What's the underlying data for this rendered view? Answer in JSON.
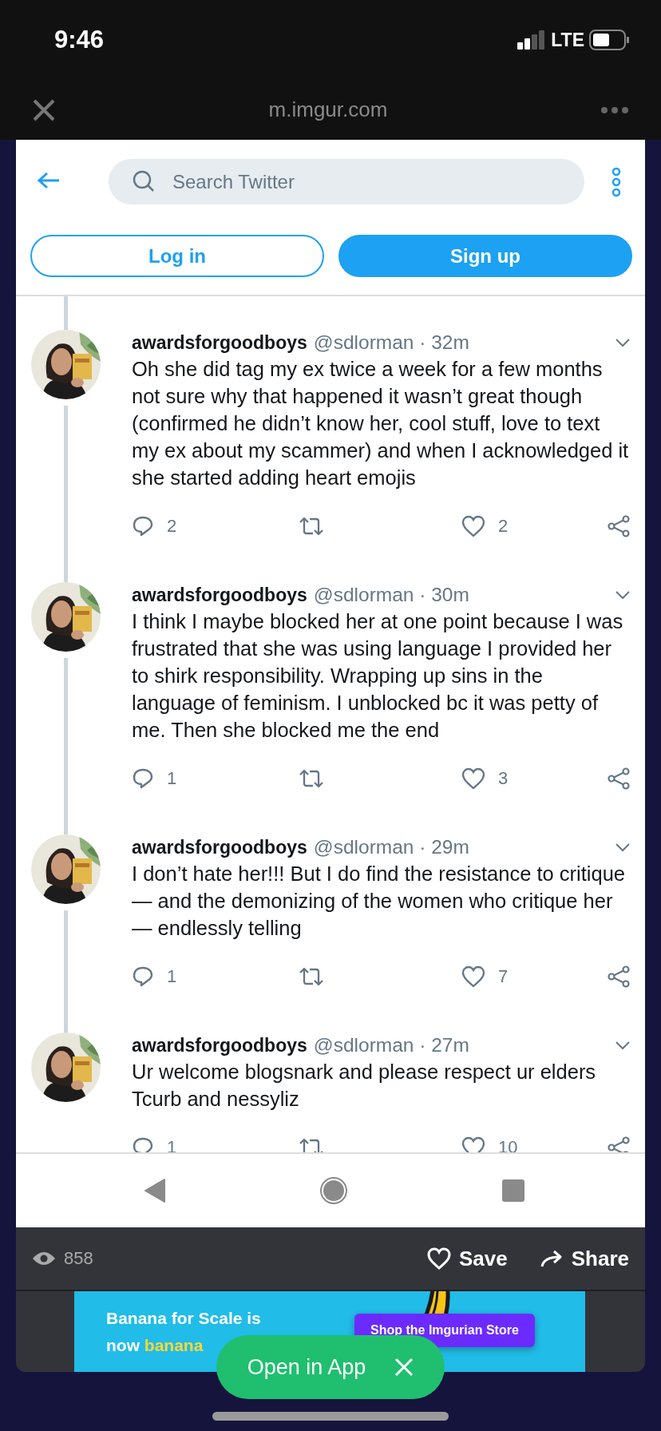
{
  "status_bar": {
    "time": "9:46",
    "network": "LTE"
  },
  "browser": {
    "url": "m.imgur.com"
  },
  "twitter_header": {
    "search": {
      "placeholder": "Search Twitter"
    },
    "buttons": [
      {
        "label": "Log in",
        "kind": "outline"
      },
      {
        "label": "Sign up",
        "kind": "filled"
      }
    ]
  },
  "tweets": [
    {
      "name": "awardsforgoodboys",
      "meta": "@sdlorman · 32m",
      "text": "Oh she did tag my ex twice a week for a few months not sure why that happened it wasn’t great though (confirmed he didn’t know her, cool stuff, love to text my ex about my scammer) and when I acknowledged it she started adding heart emojis",
      "replies": "2",
      "likes": "2"
    },
    {
      "name": "awardsforgoodboys",
      "meta": "@sdlorman · 30m",
      "text": "I think I maybe blocked her at one point because I was frustrated that she was using language I provided her to shirk responsibility. Wrapping up sins in the language of feminism. I unblocked bc it was petty of me. Then she blocked me the end",
      "replies": "1",
      "likes": "3"
    },
    {
      "name": "awardsforgoodboys",
      "meta": "@sdlorman · 29m",
      "text": "I don’t hate her!!! But I do find the resistance to critique — and the demonizing of the women who critique her — endlessly telling",
      "replies": "1",
      "likes": "7"
    },
    {
      "name": "awardsforgoodboys",
      "meta": "@sdlorman · 27m",
      "text": "Ur welcome blogsnark and please respect ur elders Tcurb and nessyliz",
      "replies": "1",
      "likes": "10"
    }
  ],
  "post_bar": {
    "views": "858",
    "actions": [
      {
        "label": "Save",
        "kind": "save"
      },
      {
        "label": "Share",
        "kind": "share"
      }
    ]
  },
  "ad": {
    "line_1": "Banana for Scale is",
    "line_2": "now",
    "line_2_highlight": "banana",
    "button": "Shop the Imgurian Store"
  },
  "open_in_app": {
    "label": "Open in App"
  }
}
